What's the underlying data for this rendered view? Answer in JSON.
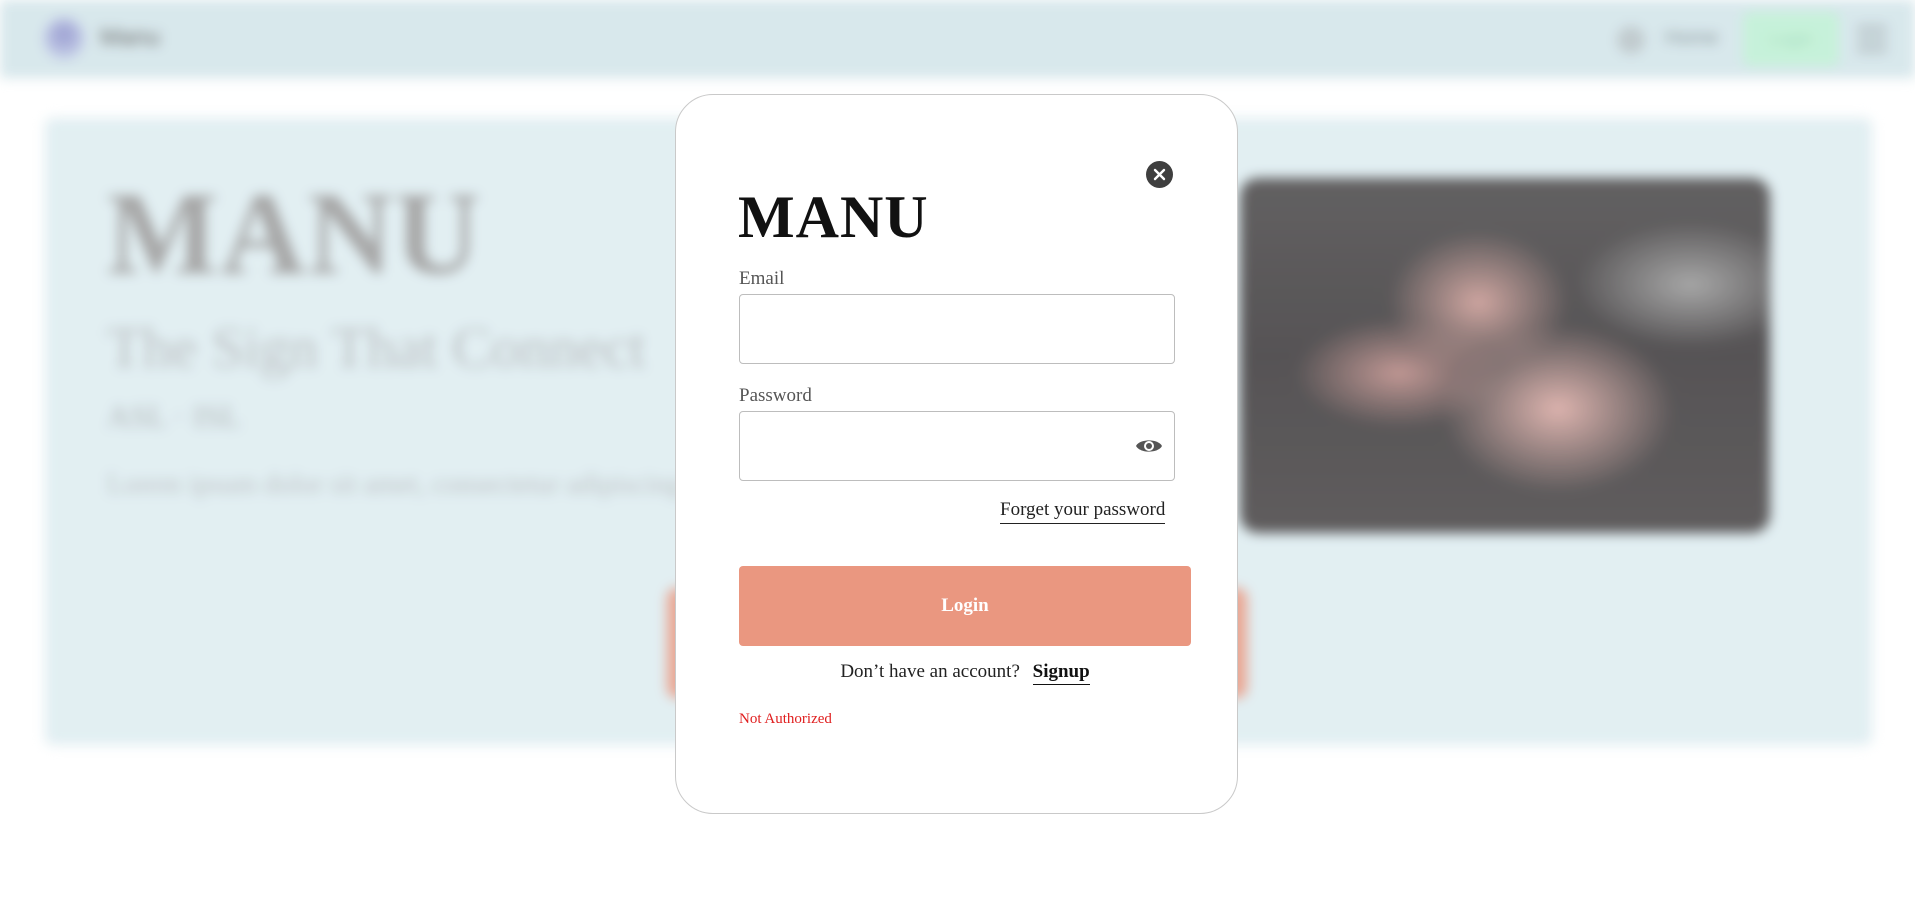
{
  "background": {
    "brand": "Manu",
    "nav_link": "Home",
    "nav_button": "Login",
    "hero_title": "MANU",
    "hero_subtitle": "The Sign That Connect",
    "hero_meta": "ASL · ISL",
    "hero_text": "Lorem ipsum dolor sit amet, consectetur adipiscing elit, sed do eiusmod tempor incididunt ut labore et dolore magna aliqua. Ut enim ad minim"
  },
  "modal": {
    "logo": "MANU",
    "email_label": "Email",
    "email_value": "",
    "password_label": "Password",
    "password_value": "",
    "forgot_label": "Forget your password",
    "login_label": "Login",
    "signup_prompt": "Don’t have an account?",
    "signup_label": "Signup",
    "error_message": "Not Authorized"
  },
  "icons": {
    "close": "close-icon",
    "password_toggle": "eye-icon"
  },
  "colors": {
    "accent": "#ea9780",
    "error": "#e01e1e",
    "topbar": "#d3e5ea",
    "hero_bg": "#deedf1"
  }
}
